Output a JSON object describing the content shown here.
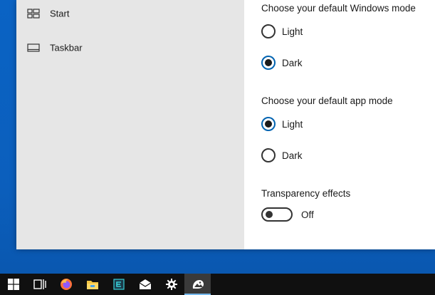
{
  "sidebar": {
    "items": [
      {
        "label": "Start",
        "icon": "start-layout-icon"
      },
      {
        "label": "Taskbar",
        "icon": "taskbar-icon"
      }
    ]
  },
  "settings": {
    "windows_mode": {
      "title": "Choose your default Windows mode",
      "options": [
        "Light",
        "Dark"
      ],
      "selected": "Dark"
    },
    "app_mode": {
      "title": "Choose your default app mode",
      "options": [
        "Light",
        "Dark"
      ],
      "selected": "Light"
    },
    "transparency": {
      "title": "Transparency effects",
      "state_label": "Off",
      "enabled": false
    }
  },
  "taskbar": {
    "items": [
      "windows-start-icon",
      "task-view-icon",
      "firefox-icon",
      "file-explorer-icon",
      "app-icon",
      "mail-icon",
      "settings-gear-icon",
      "photos-icon"
    ],
    "active": "photos-icon"
  },
  "colors": {
    "accent": "#0063b1",
    "desktop": "#0a63c4",
    "sidebar": "#e6e6e6",
    "taskbar": "#101010"
  }
}
